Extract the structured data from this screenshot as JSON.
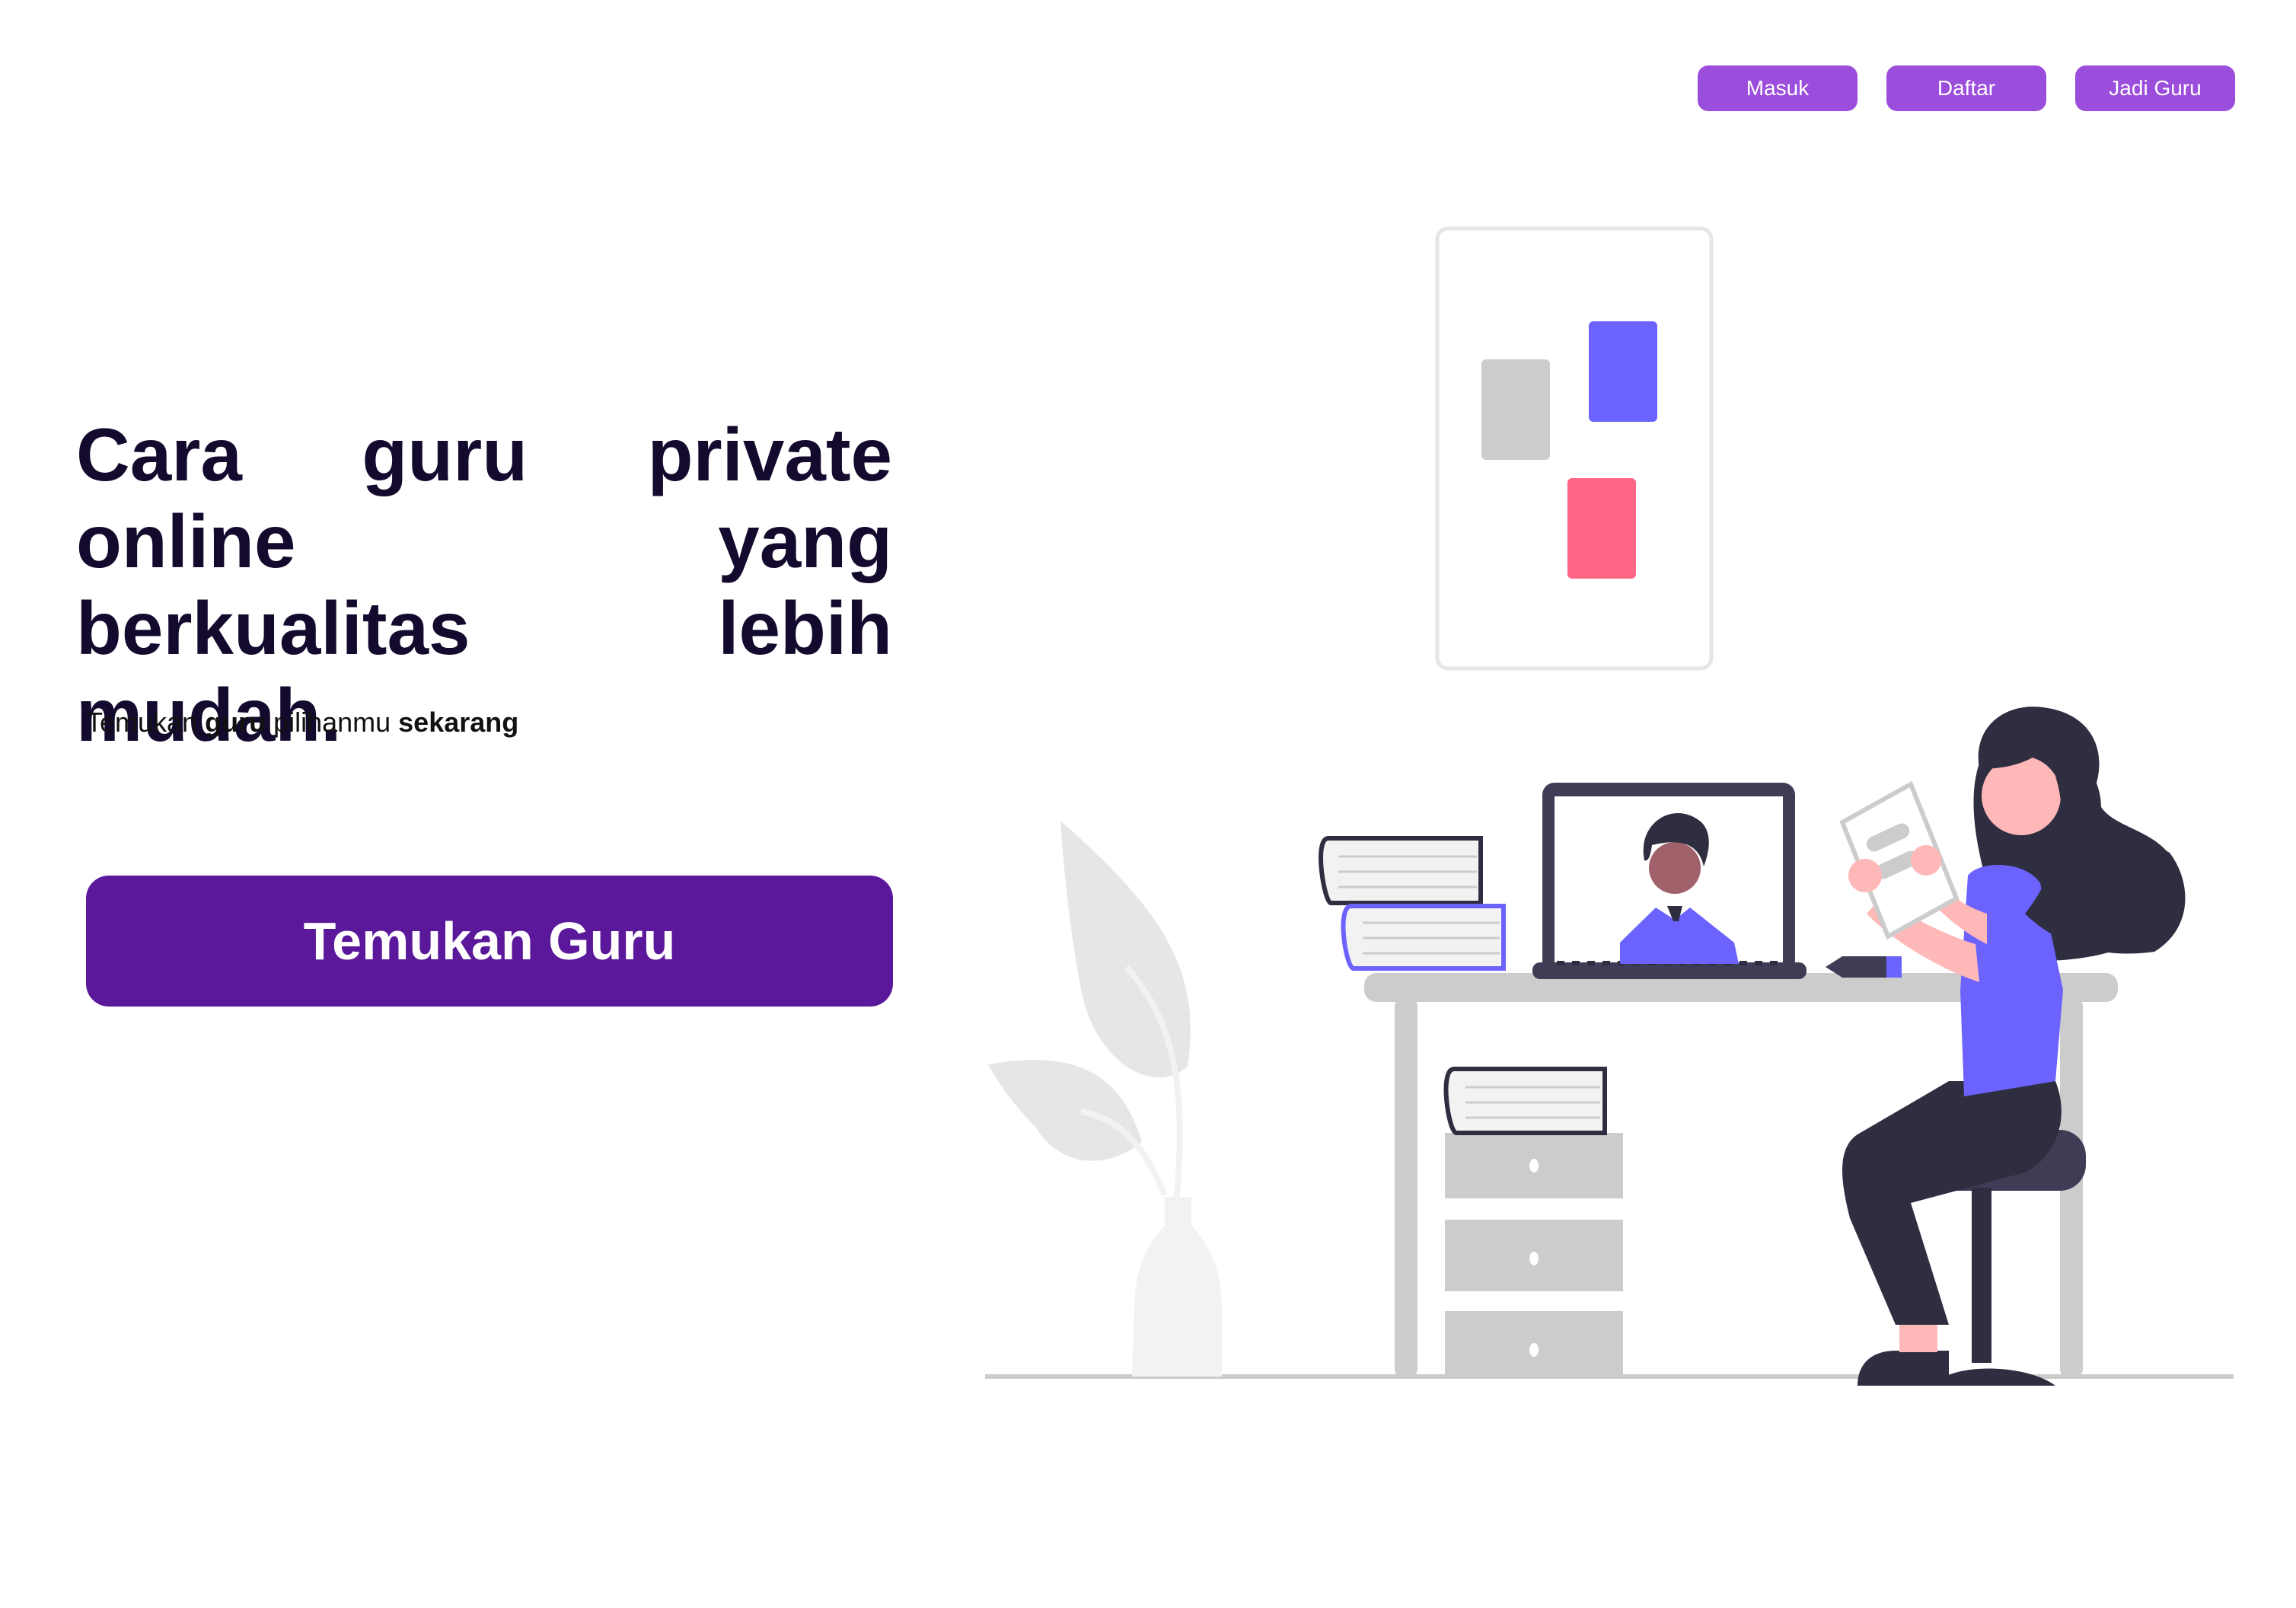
{
  "nav": {
    "masuk_label": "Masuk",
    "daftar_label": "Daftar",
    "jadi_guru_label": "Jadi Guru"
  },
  "hero": {
    "title": "Cara guru private online yang berkualitas lebih mudah.",
    "subtitle_parts": [
      "Temukan ",
      "guru",
      " pilihanmu ",
      "sekarang"
    ],
    "cta_label": "Temukan Guru"
  },
  "colors": {
    "nav_button": "#9b4ddb",
    "cta_button": "#5b189b",
    "title_text": "#130a2e",
    "accent_purple": "#6c63ff",
    "accent_pink": "#ff6584",
    "dark": "#2f2e41"
  },
  "illustration": {
    "description_icon": "online-tutoring-illustration"
  }
}
